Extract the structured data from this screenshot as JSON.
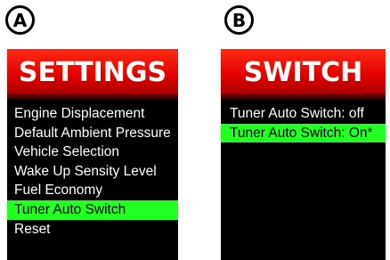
{
  "labels": {
    "a": "A",
    "b": "B"
  },
  "screens": {
    "settings": {
      "title": "SETTINGS",
      "items": [
        "Engine Displacement",
        "Default Ambient Pressure",
        "Vehicle Selection",
        "Wake Up Sensity Level",
        "Fuel Economy",
        "Tuner Auto Switch",
        "Reset"
      ],
      "selected_index": 5
    },
    "switch": {
      "title": "SWITCH",
      "items": [
        "Tuner Auto Switch: off",
        "Tuner Auto Switch: On*"
      ],
      "selected_index": 1
    }
  },
  "colors": {
    "header_red": "#e00000",
    "highlight_green": "#22ff22",
    "screen_bg": "#000000",
    "text": "#ffffff"
  }
}
